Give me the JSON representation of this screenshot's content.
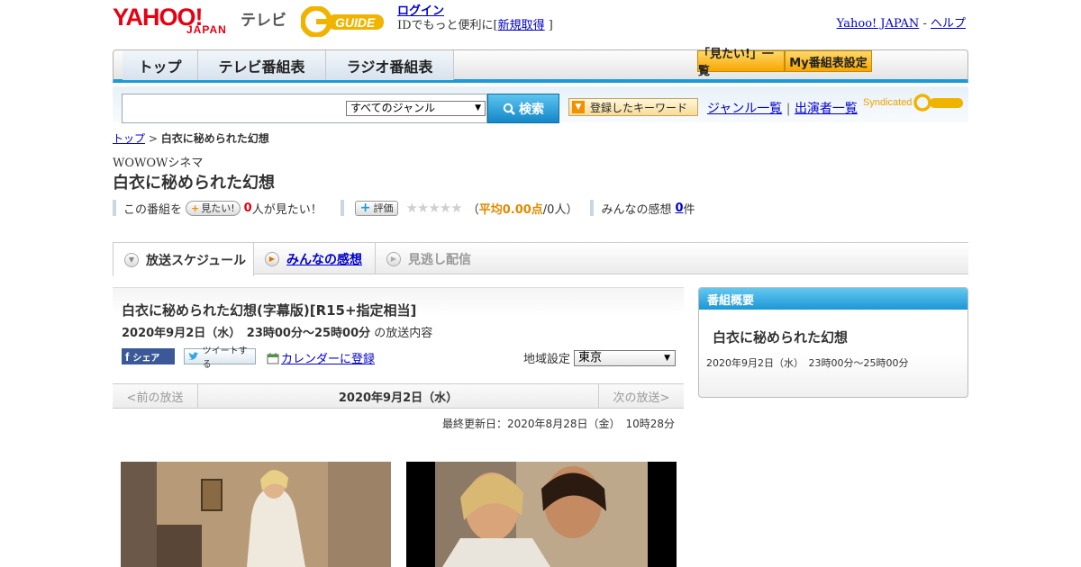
{
  "header": {
    "logo_yahoo": "YAHOO!",
    "logo_japan": "JAPAN",
    "logo_tv": "テレビ",
    "logo_guide": "GUIDE",
    "login": "ログイン",
    "login_desc_pre": "IDでもっと便利に[",
    "signup": "新規取得",
    "login_desc_post": "]",
    "yahoo_japan_link": "Yahoo! JAPAN",
    "help_sep": "-",
    "help_link": "ヘルプ"
  },
  "nav": {
    "tabs": [
      "トップ",
      "テレビ番組表",
      "ラジオ番組表"
    ],
    "wanna_see_list": "「見たい!」一覧",
    "my_listing": "My番組表設定"
  },
  "search": {
    "genre_selected": "すべてのジャンル",
    "search_button": "検索",
    "keyword_button": "登録したキーワード",
    "genre_list": "ジャンル一覧",
    "sep": "|",
    "performer_list": "出演者一覧",
    "syndicated": "Syndicated",
    "syndicated_logo": "GUIDE"
  },
  "breadcrumb": {
    "top": "トップ",
    "sep": ">",
    "current": "白衣に秘められた幻想"
  },
  "program": {
    "channel": "WOWOWシネマ",
    "title": "白衣に秘められた幻想",
    "want_prefix": "この番組を",
    "want_button": "見たい!",
    "want_count": "0",
    "want_suffix": "人が見たい！",
    "rate_button": "評価",
    "avg_open": "（",
    "avg_label": "平均0.00点",
    "avg_rest": "/0人）",
    "impressions_label": "みんなの感想",
    "impressions_count": "0",
    "impressions_suffix": "件"
  },
  "tabs": {
    "schedule": "放送スケジュール",
    "impressions": "みんなの感想",
    "missed": "見逃し配信"
  },
  "broadcast": {
    "title": "白衣に秘められた幻想(字幕版)[R15+指定相当]",
    "time": "2020年9月2日（水）　23時00分～25時00分",
    "time_suffix": "の放送内容",
    "share": "シェア",
    "tweet": "ツイートする",
    "calendar": "カレンダーに登録",
    "region_label": "地域設定",
    "region_value": "東京",
    "prev": "<前の放送",
    "date": "2020年9月2日（水）",
    "next": "次の放送>",
    "updated": "最終更新日：2020年8月28日（金）　10時28分"
  },
  "side": {
    "header": "番組概要",
    "title": "白衣に秘められた幻想",
    "time": "2020年9月2日（水）　23時00分～25時00分"
  },
  "colors": {
    "accent": "#1a9bd7",
    "brand_red": "#e60012",
    "guide_yellow": "#f0b400"
  }
}
